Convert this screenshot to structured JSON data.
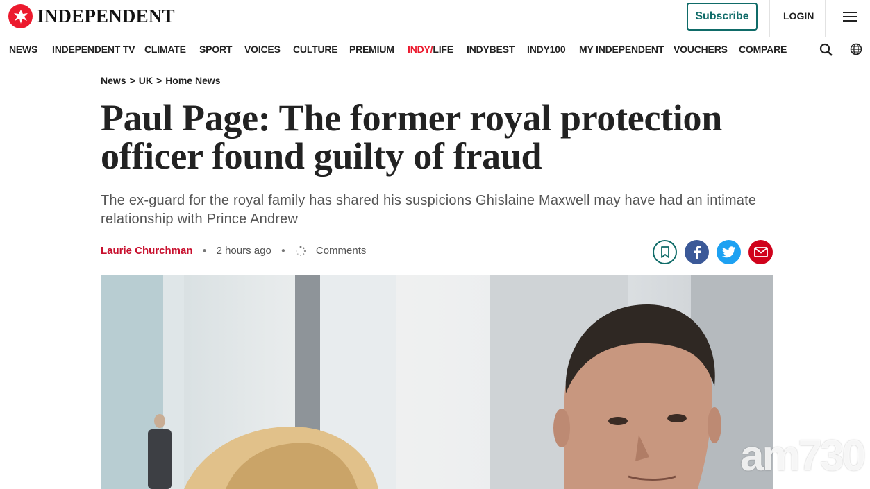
{
  "brand": {
    "name": "INDEPENDENT",
    "accent": "#ec1a2e",
    "teal": "#0f6b68"
  },
  "header": {
    "subscribe_label": "Subscribe",
    "login_label": "LOGIN"
  },
  "nav": {
    "items": [
      "NEWS",
      "INDEPENDENT TV",
      "CLIMATE",
      "SPORT",
      "VOICES",
      "CULTURE",
      "PREMIUM",
      "INDY/LIFE",
      "INDYBEST",
      "INDY100",
      "MY INDEPENDENT",
      "VOUCHERS",
      "COMPARE"
    ],
    "indy_prefix": "INDY/",
    "indy_suffix": "LIFE",
    "icons": [
      "search-icon",
      "globe-icon"
    ]
  },
  "breadcrumb": {
    "items": [
      "News",
      "UK",
      "Home News"
    ],
    "separator": ">"
  },
  "article": {
    "headline": "Paul Page: The former royal protection officer found guilty of fraud",
    "standfirst": "The ex-guard for the royal family has shared his suspicions Ghislaine Maxwell may have had an intimate relationship with Prince Andrew",
    "author": "Laurie Churchman",
    "time": "2 hours ago",
    "comments_label": "Comments",
    "share_icons": [
      "bookmark-icon",
      "facebook-icon",
      "twitter-icon",
      "mail-icon"
    ]
  },
  "hero": {
    "watermark": "am730"
  }
}
